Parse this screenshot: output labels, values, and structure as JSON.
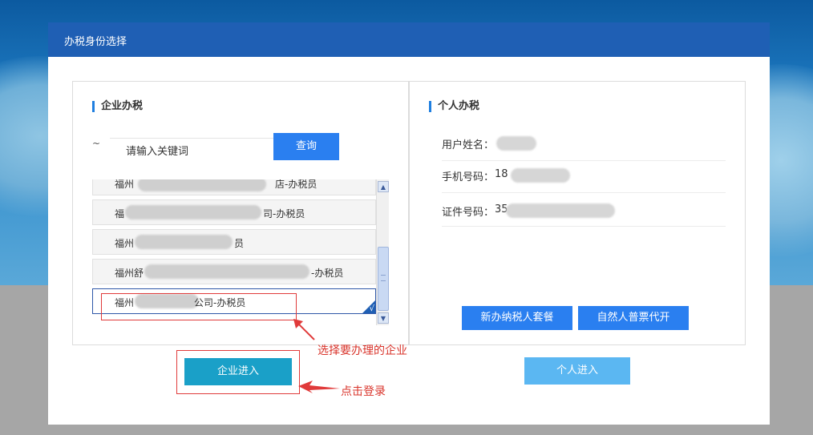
{
  "dialog": {
    "title": "办税身份选择"
  },
  "enterprise": {
    "section_title": "企业办税",
    "search_prefix": "~",
    "search_placeholder": "请输入关键词",
    "search_button": "查询",
    "items": [
      {
        "prefix": "福州",
        "suffix": "店-办税员"
      },
      {
        "prefix": "福",
        "suffix": "司-办税员"
      },
      {
        "prefix": "福州",
        "suffix": "员"
      },
      {
        "prefix": "福州舒",
        "suffix": "-办税员"
      },
      {
        "prefix": "福州",
        "suffix": "公司-办税员"
      }
    ],
    "selected_mark": "√",
    "enter_button": "企业进入"
  },
  "personal": {
    "section_title": "个人办税",
    "rows": [
      {
        "label": "用户姓名：",
        "value": ""
      },
      {
        "label": "手机号码：",
        "value": "18"
      },
      {
        "label": "证件号码：",
        "value": "35"
      }
    ],
    "buttons": [
      "新办纳税人套餐",
      "自然人普票代开"
    ],
    "enter_button": "个人进入"
  },
  "annotations": {
    "select_company": "选择要办理的企业",
    "click_login": "点击登录"
  },
  "colors": {
    "header": "#1f5fb4",
    "primary": "#2a7ff0",
    "annotation": "#d9342b"
  }
}
